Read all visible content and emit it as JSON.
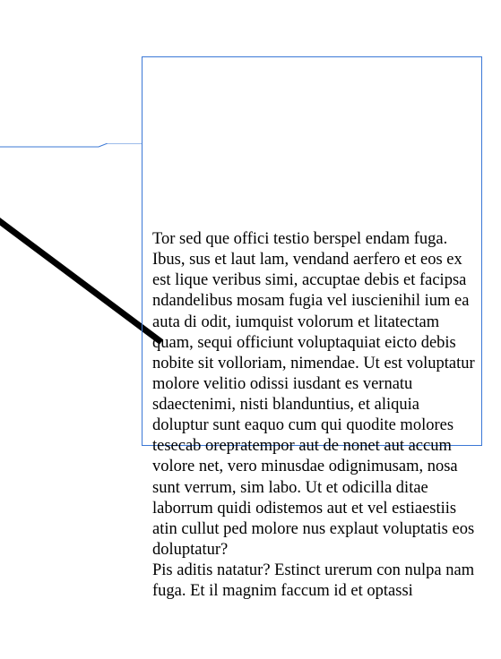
{
  "frame": {
    "border_color": "#3b78d6"
  },
  "line": {
    "stroke": "#000000",
    "stroke_width": 7
  },
  "text": {
    "paragraph1": "Tor sed que offici testio berspel endam fuga. Ibus, sus et laut lam, vendand aerfero et eos ex est lique veribus simi, accuptae debis et facipsa ndandelibus mosam fugia vel iuscienihil ium ea auta di odit, iumquist volorum et litatectam quam, sequi officiunt voluptaquiat eicto debis nobite sit volloriam, nimendae. Ut est voluptatur molore velitio odissi iusdant es vernatu sdaectenimi, nisti blanduntius, et aliquia doluptur sunt eaquo cum qui quodite molores tesecab orepratem­por aut de nonet aut accum volore net, vero minusdae odignimusam, nosa sunt verrum, sim labo. Ut et odicilla ditae laborrum quidi odistemos aut et vel estiaestiis atin cullut ped molore nus explaut voluptatis eos doluptat­ur?",
    "paragraph2": "Pis aditis natatur? Estinct urerum con nulpa nam fuga. Et il magnim faccum id et optassi"
  }
}
